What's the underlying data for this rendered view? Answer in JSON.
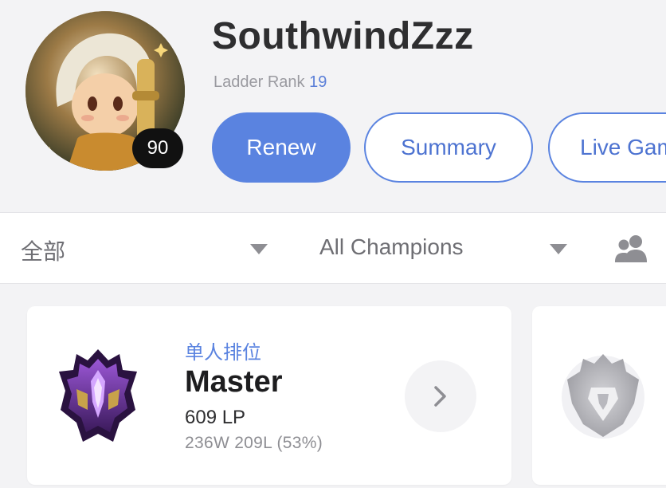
{
  "profile": {
    "summoner_name": "SouthwindZzz",
    "level": "90",
    "ladder_rank_label": "Ladder Rank",
    "ladder_rank_value": "19",
    "avatar": "chibi-champion-portrait"
  },
  "actions": {
    "renew_label": "Renew",
    "summary_label": "Summary",
    "live_game_label": "Live Game"
  },
  "filters": {
    "queue_value": "全部",
    "champion_value": "All Champions",
    "queue_icon": "caret-down-icon",
    "champion_icon": "caret-down-icon",
    "friends_icon": "friends-icon"
  },
  "ranked_solo": {
    "queue_type": "单人排位",
    "tier": "Master",
    "lp": "609 LP",
    "record": "236W 209L (53%)",
    "emblem": "master-emblem",
    "more_icon": "chevron-right-icon"
  },
  "ranked_flex": {
    "emblem": "unranked-emblem"
  },
  "colors": {
    "accent": "#5a83e0",
    "background": "#f3f3f5",
    "card": "#ffffff",
    "master_purple": "#7a3fb3"
  }
}
